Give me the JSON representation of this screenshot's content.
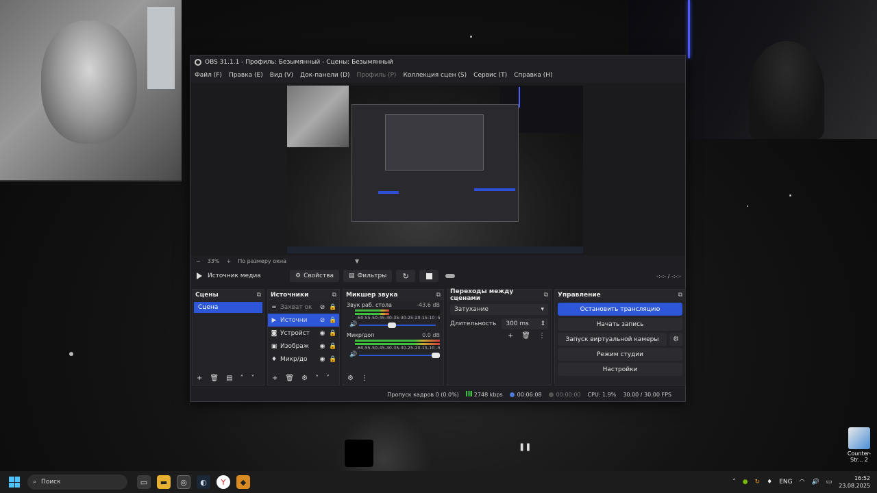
{
  "obs": {
    "title": "OBS 31.1.1 - Профиль: Безымянный - Сцены: Безымянный",
    "menu": [
      {
        "label": "Файл (F)",
        "disabled": false
      },
      {
        "label": "Правка (E)",
        "disabled": false
      },
      {
        "label": "Вид (V)",
        "disabled": false
      },
      {
        "label": "Док-панели (D)",
        "disabled": false
      },
      {
        "label": "Профиль (P)",
        "disabled": true
      },
      {
        "label": "Коллекция сцен (S)",
        "disabled": false
      },
      {
        "label": "Сервис (T)",
        "disabled": false
      },
      {
        "label": "Справка (H)",
        "disabled": false
      }
    ],
    "preview": {
      "zoom": "33%",
      "fit_label": "По размеру окна"
    },
    "media": {
      "source_name": "Источник медиа",
      "properties_label": "Свойства",
      "filters_label": "Фильтры",
      "time": "-:-:- / -:-:-"
    },
    "scenes": {
      "header": "Сцены",
      "items": [
        "Сцена"
      ]
    },
    "sources": {
      "header": "Источники",
      "items": [
        {
          "icon": "link-icon",
          "name": "Захват ок",
          "state": "dim"
        },
        {
          "icon": "play-icon",
          "name": "Источни",
          "state": "active"
        },
        {
          "icon": "camera-icon",
          "name": "Устройст",
          "state": "normal"
        },
        {
          "icon": "image-icon",
          "name": "Изображ",
          "state": "normal"
        },
        {
          "icon": "mic-icon",
          "name": "Микр/до",
          "state": "normal"
        }
      ]
    },
    "mixer": {
      "header": "Микшер звука",
      "scale": "-60-55-50-45-40-35-30-25-20-15-10 -5 0",
      "channels": [
        {
          "name": "Звук раб. стола",
          "db": "-43.6 dB",
          "level": 0.4
        },
        {
          "name": "Микр/доп",
          "db": "0.0 dB",
          "level": 1.0
        }
      ]
    },
    "transitions": {
      "header": "Переходы между сценами",
      "selected": "Затухание",
      "duration_label": "Длительность",
      "duration_value": "300 ms"
    },
    "controls": {
      "header": "Управление",
      "stop_stream": "Остановить трансляцию",
      "start_record": "Начать запись",
      "virtual_cam": "Запуск виртуальной камеры",
      "studio_mode": "Режим студии",
      "settings": "Настройки"
    },
    "status": {
      "dropped": "Пропуск кадров 0 (0.0%)",
      "bitrate": "2748 kbps",
      "stream_time": "00:06:08",
      "rec_time": "00:00:00",
      "cpu": "CPU: 1.9%",
      "fps": "30.00 / 30.00 FPS"
    }
  },
  "desktop": {
    "icon_label": "Counter-Str... 2"
  },
  "taskbar": {
    "search_placeholder": "Поиск",
    "lang": "ENG",
    "time": "16:52",
    "date": "23.08.2025"
  },
  "colors": {
    "accent": "#2d57d8",
    "meter_green": "#3fbf3f",
    "meter_red": "#d23a3a"
  }
}
